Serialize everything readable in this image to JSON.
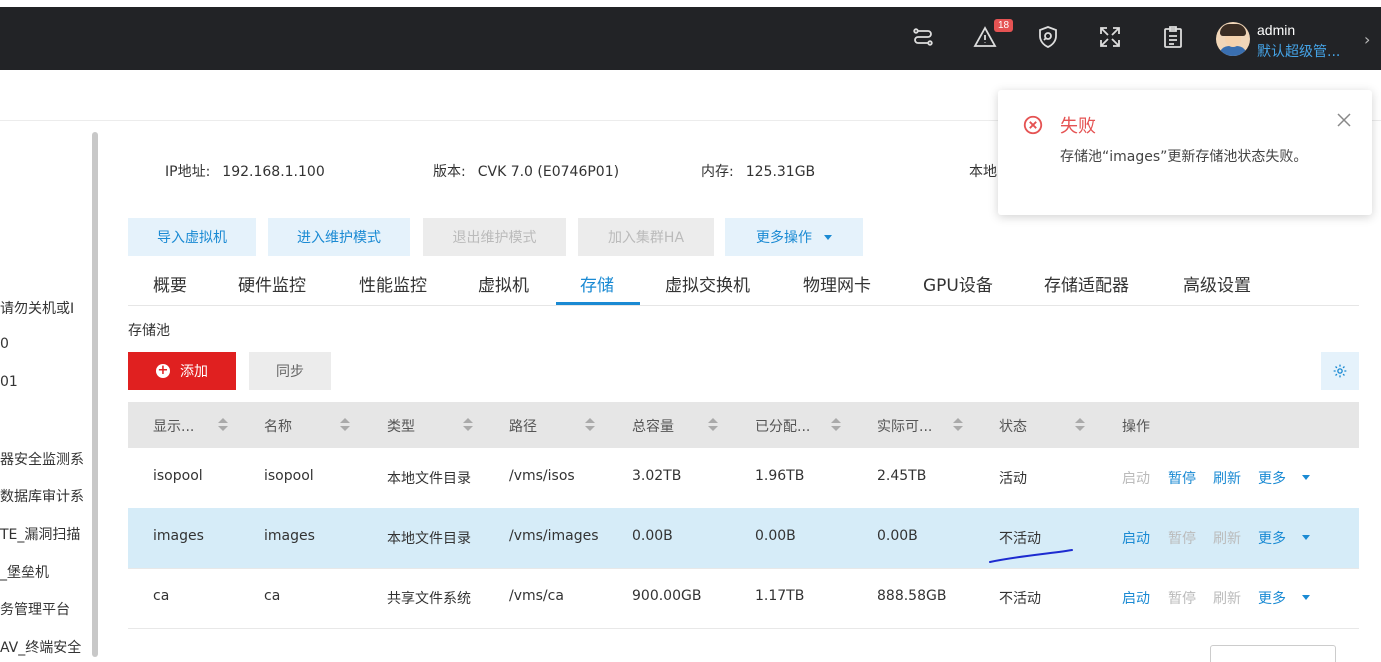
{
  "header": {
    "alert_count": "18",
    "user_name": "admin",
    "user_role": "默认超级管..."
  },
  "sidebar": {
    "items": [
      "请勿关机或Ⅰ",
      "0",
      "01",
      "器安全监测系",
      "数据库审计系",
      "TE_漏洞扫描",
      "_堡垒机",
      "务管理平台",
      "AV_终端安全"
    ]
  },
  "info": {
    "ip_label": "IP地址:",
    "ip_value": "192.168.1.100",
    "version_label": "版本:",
    "version_value": "CVK 7.0 (E0746P01)",
    "memory_label": "内存:",
    "memory_value": "125.31GB",
    "local_label": "本地"
  },
  "actions": {
    "import_vm": "导入虚拟机",
    "enter_maintenance": "进入维护模式",
    "exit_maintenance": "退出维护模式",
    "join_cluster_ha": "加入集群HA",
    "more_ops": "更多操作"
  },
  "tabs": [
    "概要",
    "硬件监控",
    "性能监控",
    "虚拟机",
    "存储",
    "虚拟交换机",
    "物理网卡",
    "GPU设备",
    "存储适配器",
    "高级设置"
  ],
  "storage": {
    "section_label": "存储池",
    "add_label": "添加",
    "sync_label": "同步",
    "columns": [
      "显示...",
      "名称",
      "类型",
      "路径",
      "总容量",
      "已分配...",
      "实际可...",
      "状态",
      "操作"
    ],
    "rows": [
      {
        "display": "isopool",
        "name": "isopool",
        "type": "本地文件目录",
        "path": "/vms/isos",
        "total": "3.02TB",
        "allocated": "1.96TB",
        "available": "2.45TB",
        "status": "活动",
        "start": "启动",
        "pause": "暂停",
        "refresh": "刷新",
        "more": "更多"
      },
      {
        "display": "images",
        "name": "images",
        "type": "本地文件目录",
        "path": "/vms/images",
        "total": "0.00B",
        "allocated": "0.00B",
        "available": "0.00B",
        "status": "不活动",
        "start": "启动",
        "pause": "暂停",
        "refresh": "刷新",
        "more": "更多"
      },
      {
        "display": "ca",
        "name": "ca",
        "type": "共享文件系统",
        "path": "/vms/ca",
        "total": "900.00GB",
        "allocated": "1.17TB",
        "available": "888.58GB",
        "status": "不活动",
        "start": "启动",
        "pause": "暂停",
        "refresh": "刷新",
        "more": "更多"
      }
    ]
  },
  "toast": {
    "title": "失败",
    "message": "存储池“images”更新存储池状态失败。"
  },
  "colors": {
    "accent": "#1a8ad3",
    "danger": "#e02020",
    "error_text": "#e55353",
    "selected_row": "#d6ecf8",
    "topbar": "#222326"
  }
}
